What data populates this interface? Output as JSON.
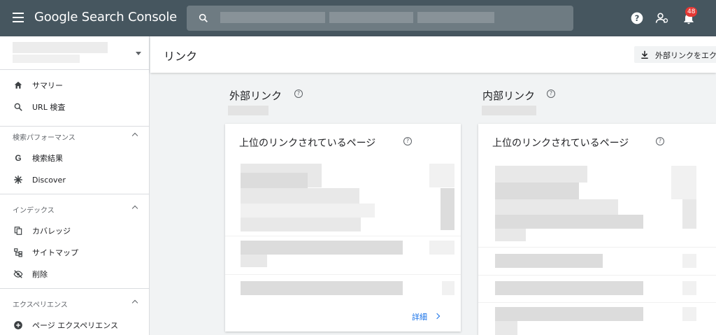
{
  "app": {
    "title": "Google Search Console",
    "search_placeholder": "",
    "notification_count": "48"
  },
  "sidebar": {
    "items_top": [
      {
        "label": "サマリー",
        "icon": "home-icon"
      },
      {
        "label": "URL 検査",
        "icon": "search-icon"
      }
    ],
    "sections": [
      {
        "label": "検索パフォーマンス",
        "items": [
          {
            "label": "検索結果",
            "icon": "google-g-icon"
          },
          {
            "label": "Discover",
            "icon": "asterisk-icon"
          }
        ]
      },
      {
        "label": "インデックス",
        "items": [
          {
            "label": "カバレッジ",
            "icon": "copy-icon"
          },
          {
            "label": "サイトマップ",
            "icon": "sitemap-icon"
          },
          {
            "label": "削除",
            "icon": "eye-off-icon"
          }
        ]
      },
      {
        "label": "エクスペリエンス",
        "items": [
          {
            "label": "ページ エクスペリエンス",
            "icon": "add-circle-icon"
          }
        ]
      }
    ]
  },
  "main": {
    "page_title": "リンク",
    "export_label": "外部リンクをエク",
    "columns": [
      {
        "title": "外部リンク",
        "card_title": "上位のリンクされているページ",
        "detail_label": "詳細"
      },
      {
        "title": "内部リンク",
        "card_title": "上位のリンクされているページ"
      }
    ]
  }
}
